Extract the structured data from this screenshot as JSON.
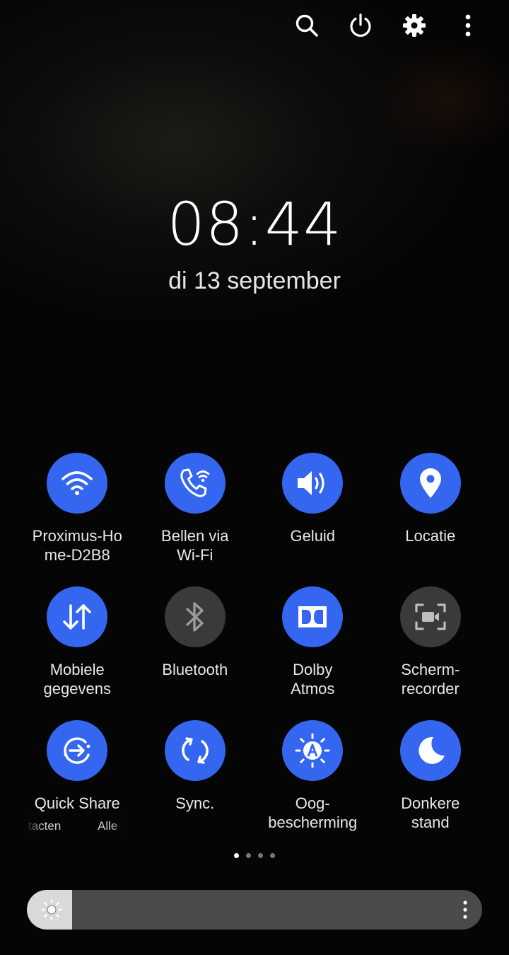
{
  "header": {
    "actions": [
      {
        "icon": "search-icon"
      },
      {
        "icon": "power-icon"
      },
      {
        "icon": "gear-icon"
      },
      {
        "icon": "more-vertical-icon"
      }
    ]
  },
  "clock": {
    "time": "08:44",
    "date": "di 13 september"
  },
  "tiles": [
    {
      "label": "Proximus-Ho\nme-D2B8",
      "icon": "wifi-icon",
      "active": true
    },
    {
      "label": "Bellen via\nWi-Fi",
      "icon": "wifi-calling-icon",
      "active": true
    },
    {
      "label": "Geluid",
      "icon": "sound-icon",
      "active": true
    },
    {
      "label": "Locatie",
      "icon": "location-icon",
      "active": true
    },
    {
      "label": "Mobiele\ngegevens",
      "icon": "mobile-data-icon",
      "active": true
    },
    {
      "label": "Bluetooth",
      "icon": "bluetooth-icon",
      "active": false
    },
    {
      "label": "Dolby\nAtmos",
      "icon": "dolby-icon",
      "active": true
    },
    {
      "label": "Scherm-\nrecorder",
      "icon": "screen-recorder-icon",
      "active": false
    },
    {
      "label": "Quick Share",
      "icon": "quick-share-icon",
      "active": true
    },
    {
      "label": "Sync.",
      "icon": "sync-icon",
      "active": true
    },
    {
      "label": "Oog-\nbescherming",
      "icon": "eye-comfort-icon",
      "active": true
    },
    {
      "label": "Donkere\nstand",
      "icon": "dark-mode-icon",
      "active": true
    }
  ],
  "quick_share_sub": {
    "left": "tacten",
    "right": "Alle"
  },
  "pager": {
    "pages": 4,
    "current": 1
  },
  "brightness": {
    "level": 0.1,
    "icon": "brightness-icon"
  },
  "colors": {
    "active_tile": "#3466f0",
    "inactive_tile": "#3a3a3a",
    "brightness_fill": "#d9d9d9",
    "brightness_track": "#4a4a4a"
  }
}
